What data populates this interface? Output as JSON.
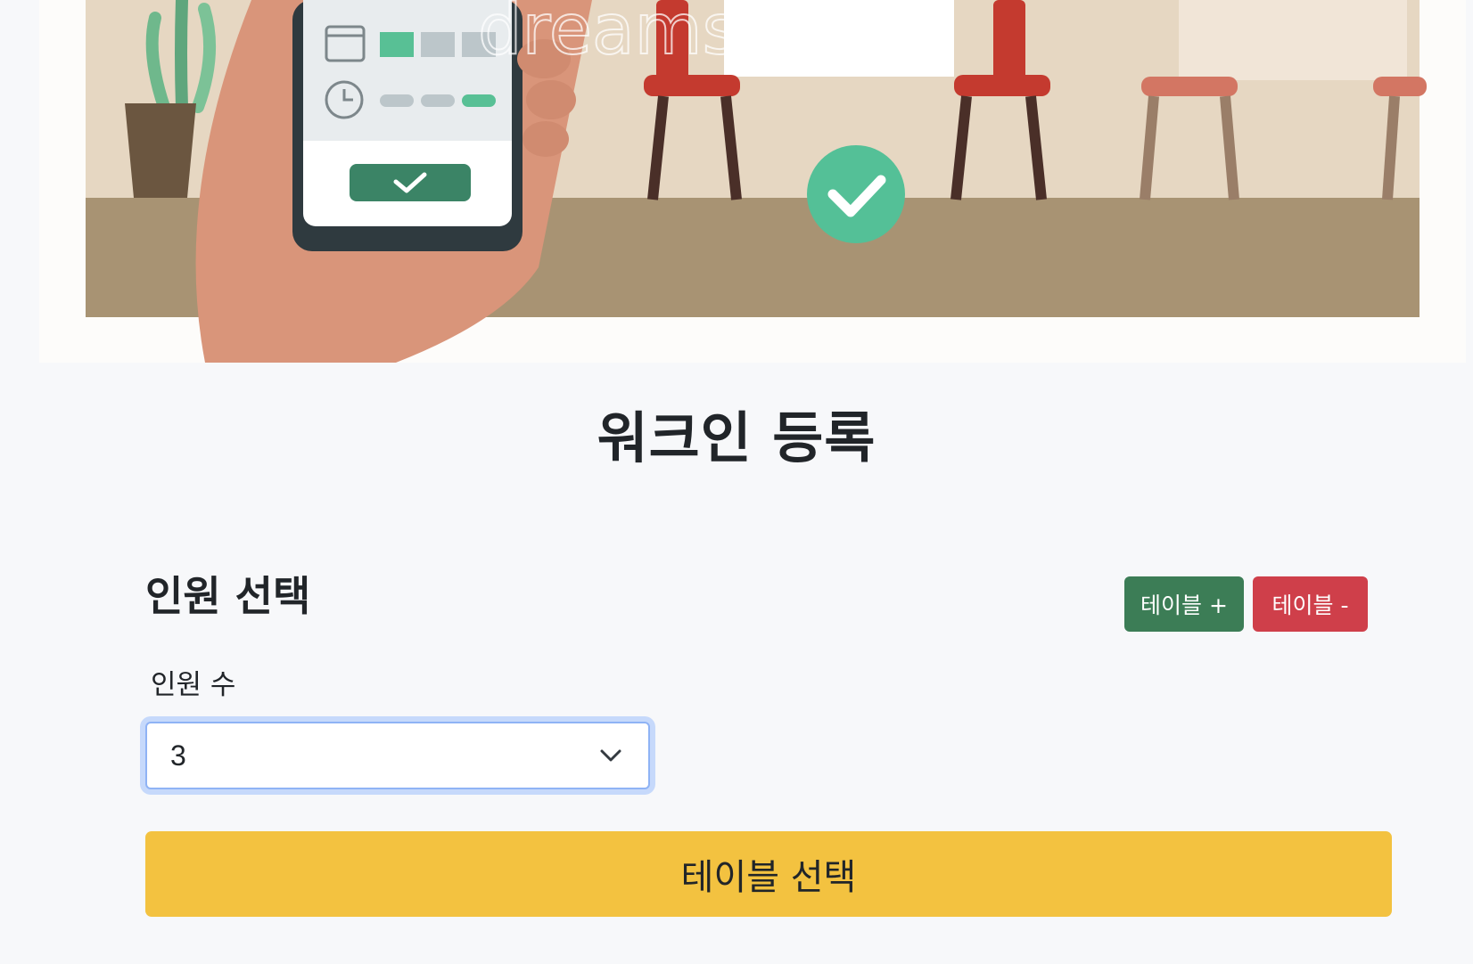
{
  "hero": {
    "illustration_icon": "restaurant-booking-illustration",
    "watermark": "dreamstime"
  },
  "page_title": "워크인 등록",
  "section_title": "인원 선택",
  "table_controls": {
    "add_label": "테이블 +",
    "remove_label": "테이블 -",
    "add_color": "#3c7d56",
    "remove_color": "#cf3f4a"
  },
  "party_size": {
    "label": "인원 수",
    "selected": "3"
  },
  "primary_action": {
    "label": "테이블 선택",
    "color": "#f3c240"
  }
}
